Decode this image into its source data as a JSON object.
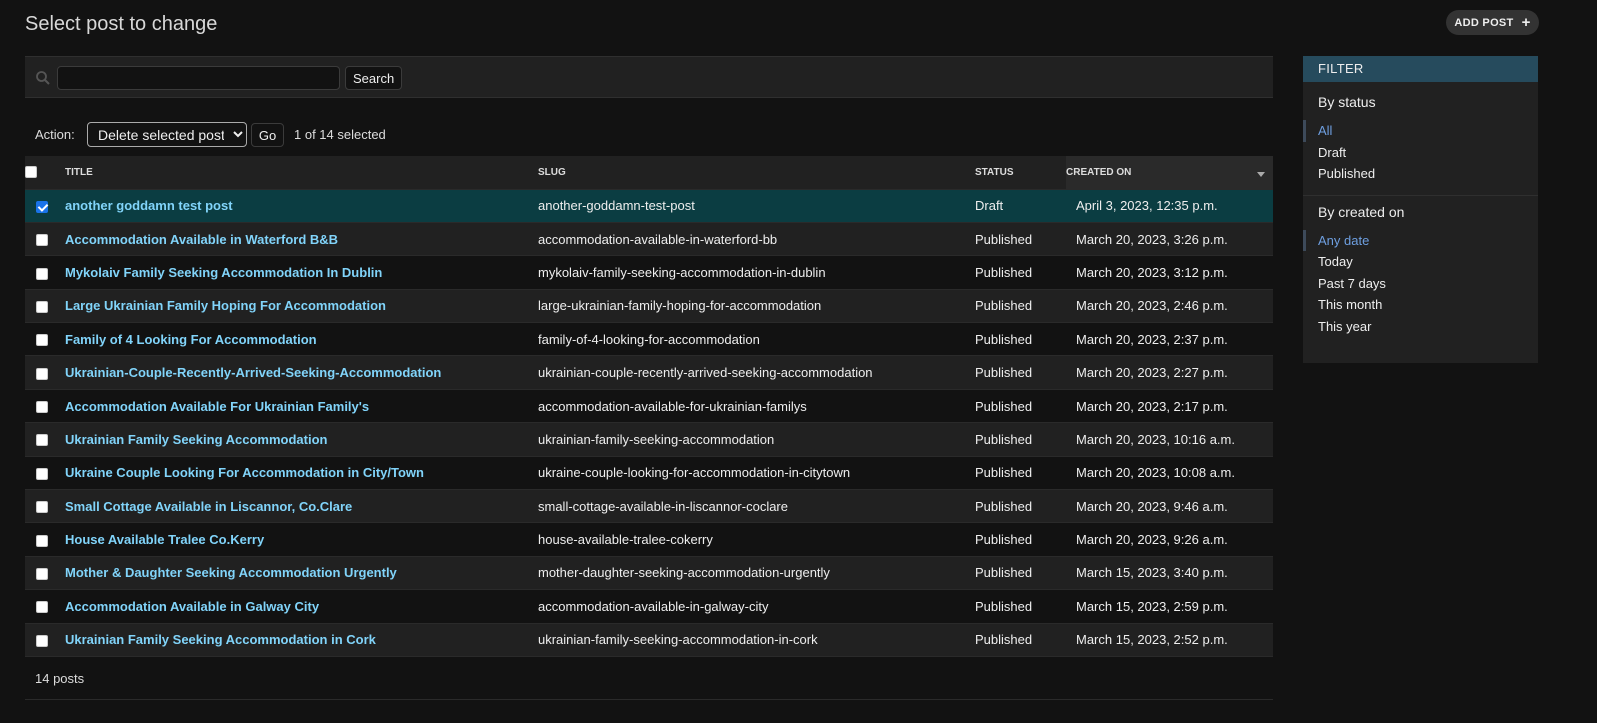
{
  "header": {
    "title": "Select post to change",
    "add_label": "ADD POST"
  },
  "search": {
    "value": "",
    "placeholder": "",
    "button": "Search"
  },
  "actions": {
    "label": "Action:",
    "selected": "Delete selected posts",
    "go": "Go",
    "counter": "1 of 14 selected"
  },
  "table": {
    "columns": [
      "TITLE",
      "SLUG",
      "STATUS",
      "CREATED ON"
    ],
    "sorted_column": "CREATED ON",
    "rows": [
      {
        "checked": true,
        "title": "another goddamn test post",
        "slug": "another-goddamn-test-post",
        "status": "Draft",
        "created": "April 3, 2023, 12:35 p.m."
      },
      {
        "checked": false,
        "title": "Accommodation Available in Waterford B&B",
        "slug": "accommodation-available-in-waterford-bb",
        "status": "Published",
        "created": "March 20, 2023, 3:26 p.m."
      },
      {
        "checked": false,
        "title": "Mykolaiv Family Seeking Accommodation In Dublin",
        "slug": "mykolaiv-family-seeking-accommodation-in-dublin",
        "status": "Published",
        "created": "March 20, 2023, 3:12 p.m."
      },
      {
        "checked": false,
        "title": "Large Ukrainian Family Hoping For Accommodation",
        "slug": "large-ukrainian-family-hoping-for-accommodation",
        "status": "Published",
        "created": "March 20, 2023, 2:46 p.m."
      },
      {
        "checked": false,
        "title": "Family of 4 Looking For Accommodation",
        "slug": "family-of-4-looking-for-accommodation",
        "status": "Published",
        "created": "March 20, 2023, 2:37 p.m."
      },
      {
        "checked": false,
        "title": "Ukrainian-Couple-Recently-Arrived-Seeking-Accommodation",
        "slug": "ukrainian-couple-recently-arrived-seeking-accommodation",
        "status": "Published",
        "created": "March 20, 2023, 2:27 p.m."
      },
      {
        "checked": false,
        "title": "Accommodation Available For Ukrainian Family's",
        "slug": "accommodation-available-for-ukrainian-familys",
        "status": "Published",
        "created": "March 20, 2023, 2:17 p.m."
      },
      {
        "checked": false,
        "title": "Ukrainian Family Seeking Accommodation",
        "slug": "ukrainian-family-seeking-accommodation",
        "status": "Published",
        "created": "March 20, 2023, 10:16 a.m."
      },
      {
        "checked": false,
        "title": "Ukraine Couple Looking For Accommodation in City/Town",
        "slug": "ukraine-couple-looking-for-accommodation-in-citytown",
        "status": "Published",
        "created": "March 20, 2023, 10:08 a.m."
      },
      {
        "checked": false,
        "title": "Small Cottage Available in Liscannor, Co.Clare",
        "slug": "small-cottage-available-in-liscannor-coclare",
        "status": "Published",
        "created": "March 20, 2023, 9:46 a.m."
      },
      {
        "checked": false,
        "title": "House Available Tralee Co.Kerry",
        "slug": "house-available-tralee-cokerry",
        "status": "Published",
        "created": "March 20, 2023, 9:26 a.m."
      },
      {
        "checked": false,
        "title": "Mother & Daughter Seeking Accommodation Urgently",
        "slug": "mother-daughter-seeking-accommodation-urgently",
        "status": "Published",
        "created": "March 15, 2023, 3:40 p.m."
      },
      {
        "checked": false,
        "title": "Accommodation Available in Galway City",
        "slug": "accommodation-available-in-galway-city",
        "status": "Published",
        "created": "March 15, 2023, 2:59 p.m."
      },
      {
        "checked": false,
        "title": "Ukrainian Family Seeking Accommodation in Cork",
        "slug": "ukrainian-family-seeking-accommodation-in-cork",
        "status": "Published",
        "created": "March 15, 2023, 2:52 p.m."
      }
    ]
  },
  "paginator": {
    "text": "14 posts"
  },
  "filter": {
    "title": "FILTER",
    "groups": [
      {
        "heading": "By status",
        "items": [
          "All",
          "Draft",
          "Published"
        ],
        "selected": "All"
      },
      {
        "heading": "By created on",
        "items": [
          "Any date",
          "Today",
          "Past 7 days",
          "This month",
          "This year"
        ],
        "selected": "Any date"
      }
    ]
  },
  "colors": {
    "link": "#81d4fa",
    "selected_row": "#0b3d42",
    "filter_header": "#264b5d",
    "filter_selected": "#6e9fe0"
  }
}
